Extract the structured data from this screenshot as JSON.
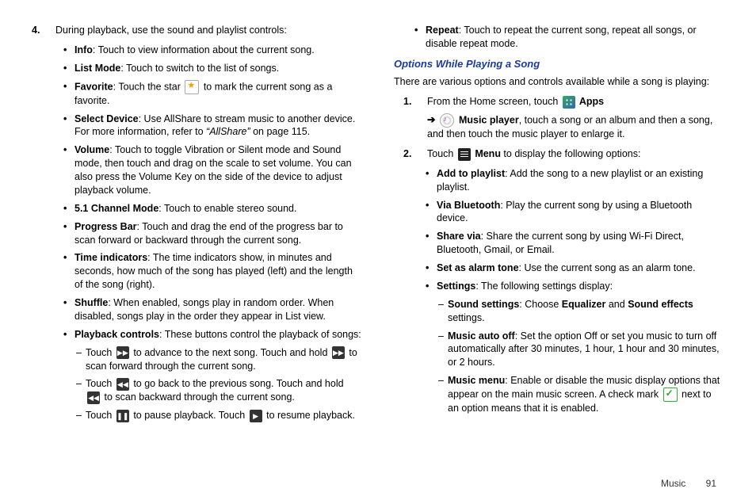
{
  "left": {
    "step4_num": "4.",
    "step4_text": "During playback, use the sound and playlist controls:",
    "b_info_label": "Info",
    "b_info_text": ": Touch to view information about the current song.",
    "b_list_label": "List Mode",
    "b_list_text": ": Touch to switch to the list of songs.",
    "b_fav_label": "Favorite",
    "b_fav_text1": ": Touch the star ",
    "b_fav_text2": " to mark the current song as a favorite.",
    "b_sel_label": "Select Device",
    "b_sel_text1": ": Use AllShare to stream music to another device. For more information, refer to ",
    "b_sel_ref": "“AllShare”",
    "b_sel_text2": "  on page 115.",
    "b_vol_label": "Volume",
    "b_vol_text": ": Touch to toggle Vibration or Silent mode and Sound mode, then touch and drag on the scale to set volume. You can also press the Volume Key on the side of the device to adjust playback volume.",
    "b_ch_label": "5.1 Channel Mode",
    "b_ch_text": ": Touch to enable stereo sound.",
    "b_prog_label": "Progress Bar",
    "b_prog_text": ": Touch and drag the end of the progress bar to scan forward or backward through the current song.",
    "b_time_label": "Time indicators",
    "b_time_text": ": The time indicators show, in minutes and seconds, how much of the song has played (left) and the length of the song (right).",
    "b_shuf_label": "Shuffle",
    "b_shuf_text": ": When enabled, songs play in random order. When disabled, songs play in the order they appear in List view.",
    "b_play_label": "Playback controls",
    "b_play_text": ": These buttons control the playback of songs:",
    "d1a": "Touch ",
    "d1b": " to advance to the next song. Touch and hold ",
    "d1c": " to scan forward through the current song.",
    "d2a": "Touch ",
    "d2b": " to go back to the previous song. Touch and hold ",
    "d2c": " to scan backward through the current song.",
    "d3a": "Touch ",
    "d3b": " to pause playback. Touch ",
    "d3c": " to resume playback."
  },
  "right": {
    "b_rep_label": "Repeat",
    "b_rep_text": ": Touch to repeat the current song, repeat all songs, or disable repeat mode.",
    "heading": "Options While Playing a Song",
    "intro": "There are various options and controls available while a song is playing:",
    "s1_num": "1.",
    "s1_a": "From the Home screen, touch ",
    "s1_apps": " Apps",
    "arrow": "➔",
    "s1_mp": " Music player",
    "s1_b": ", touch a song or an album and then a song, and then touch the music player to enlarge it.",
    "s2_num": "2.",
    "s2_a": "Touch ",
    "s2_menu": " Menu",
    "s2_b": " to display the following options:",
    "b_add_label": "Add to playlist",
    "b_add_text": ": Add the song to a new playlist or an existing playlist.",
    "b_bt_label": "Via Bluetooth",
    "b_bt_text": ": Play the current song by using a Bluetooth device.",
    "b_share_label": "Share via",
    "b_share_text": ": Share the current song by using Wi-Fi Direct, Bluetooth, Gmail, or Email.",
    "b_alarm_label": "Set as alarm tone",
    "b_alarm_text": ": Use the current song as an alarm tone.",
    "b_set_label": "Settings",
    "b_set_text": ": The following settings display:",
    "d_ss_label": "Sound settings",
    "d_ss_a": ": Choose ",
    "d_ss_eq": "Equalizer",
    "d_ss_b": " and ",
    "d_ss_fx": "Sound effects",
    "d_ss_c": " settings.",
    "d_auto_label": "Music auto off",
    "d_auto_text": ": Set the option Off or set you music to turn off automatically after 30 minutes, 1 hour, 1 hour and 30 minutes, or 2 hours.",
    "d_mm_label": "Music menu",
    "d_mm_a": ": Enable or disable the music display options that appear on the main music screen. A check mark ",
    "d_mm_b": " next to an option means that it is enabled."
  },
  "footer": {
    "section": "Music",
    "page": "91"
  }
}
